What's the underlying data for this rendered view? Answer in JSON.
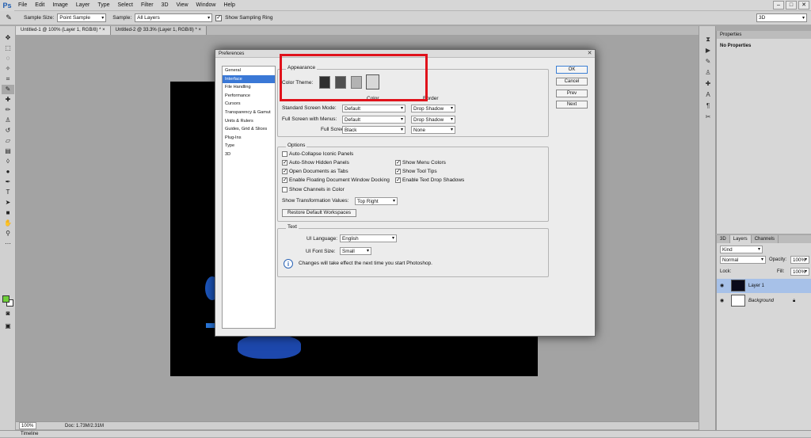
{
  "menubar": {
    "logo": "Ps",
    "items": [
      "File",
      "Edit",
      "Image",
      "Layer",
      "Type",
      "Select",
      "Filter",
      "3D",
      "View",
      "Window",
      "Help"
    ],
    "controls": [
      "–",
      "□",
      "✕"
    ]
  },
  "options": {
    "sample_size_label": "Sample Size:",
    "sample_size_value": "Point Sample",
    "sample_label": "Sample:",
    "sample_value": "All Layers",
    "show_ring_label": "Show Sampling Ring",
    "workspace_value": "3D"
  },
  "tabs": [
    "Untitled-1 @ 100% (Layer 1, RGB/8) *  ×",
    "Untitled-2 @ 33.3% (Layer 1, RGB/8) *  ×"
  ],
  "status": {
    "zoom": "100%",
    "doc": "Doc: 1.73M/2.31M"
  },
  "timeline_label": "Timeline",
  "properties": {
    "tab": "Properties",
    "title": "No Properties"
  },
  "layers": {
    "tabs": [
      "3D",
      "Layers",
      "Channels"
    ],
    "filter": "Kind",
    "blend": "Normal",
    "opacity_label": "Opacity:",
    "opacity_value": "100%",
    "lock_label": "Lock:",
    "fill_label": "Fill:",
    "fill_value": "100%",
    "items": [
      {
        "name": "Layer 1"
      },
      {
        "name": "Background"
      }
    ]
  },
  "dialog": {
    "title": "Preferences",
    "close": "✕",
    "categories": [
      "General",
      "Interface",
      "File Handling",
      "Performance",
      "Cursors",
      "Transparency & Gamut",
      "Units & Rulers",
      "Guides, Grid & Slices",
      "Plug-Ins",
      "Type",
      "3D"
    ],
    "selected_category": "Interface",
    "buttons": {
      "ok": "OK",
      "cancel": "Cancel",
      "prev": "Prev",
      "next": "Next"
    },
    "appearance": {
      "legend": "Appearance",
      "color_theme_label": "Color Theme:",
      "theme_colors": [
        "#2e2e2e",
        "#505050",
        "#b3b3b3",
        "#d8d8d8"
      ],
      "color_header": "Color",
      "border_header": "Border",
      "rows": [
        {
          "label": "Standard Screen Mode:",
          "color": "Default",
          "border": "Drop Shadow"
        },
        {
          "label": "Full Screen with Menus:",
          "color": "Default",
          "border": "Drop Shadow"
        },
        {
          "label": "Full Screen:",
          "color": "Black",
          "border": "None"
        }
      ]
    },
    "options": {
      "legend": "Options",
      "checks": [
        {
          "label": "Auto-Collapse Iconic Panels",
          "checked": ""
        },
        {
          "label": "Auto-Show Hidden Panels",
          "checked": "✓"
        },
        {
          "label": "Open Documents as Tabs",
          "checked": "✓"
        },
        {
          "label": "Enable Floating Document Window Docking",
          "checked": "✓"
        },
        {
          "label": "Show Channels in Color",
          "checked": ""
        },
        {
          "label": "Show Menu Colors",
          "checked": "✓"
        },
        {
          "label": "Show Tool Tips",
          "checked": "✓"
        },
        {
          "label": "Enable Text Drop Shadows",
          "checked": "✓"
        }
      ],
      "transform_label": "Show Transformation Values:",
      "transform_value": "Top Right",
      "restore_label": "Restore Default Workspaces"
    },
    "text": {
      "legend": "Text",
      "language_label": "UI Language:",
      "language_value": "English",
      "font_size_label": "UI Font Size:",
      "font_size_value": "Small",
      "note": "Changes will take effect the next time you start Photoshop."
    }
  }
}
